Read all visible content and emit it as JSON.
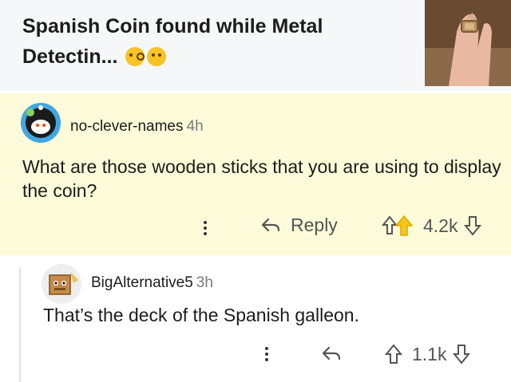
{
  "post": {
    "title": "Spanish Coin found while Metal Detectin...",
    "thumbnail_icon": "ring-hand-photo"
  },
  "comments": [
    {
      "username": "no-clever-names",
      "time": "4h",
      "body": "What are those wooden sticks that you are using to display the coin?",
      "more_icon": "more-vertical-icon",
      "reply_label": "Reply",
      "score": "4.2k",
      "highlight_color": "#fdfbd9"
    },
    {
      "username": "BigAlternative5",
      "time": "3h",
      "body": "That’s the deck of the Spanish galleon.",
      "score": "1.1k"
    }
  ]
}
